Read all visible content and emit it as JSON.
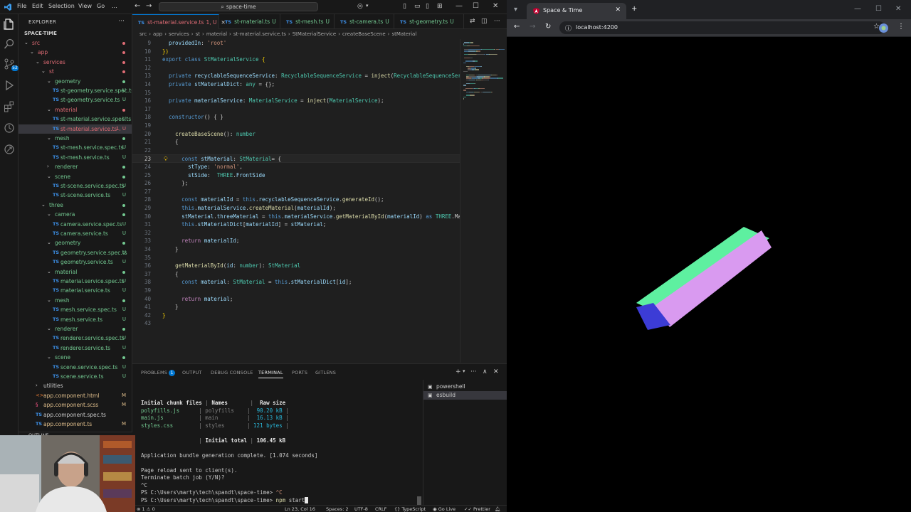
{
  "titlebar": {
    "menu": [
      "File",
      "Edit",
      "Selection",
      "View",
      "Go",
      "..."
    ],
    "search": "space-time"
  },
  "explorer": {
    "header": "EXPLORER",
    "project": "SPACE-TIME",
    "outline": "OUTLINE",
    "rows": [
      {
        "label": "src",
        "depth": 0,
        "kind": "folder",
        "open": true,
        "color": "#e06c75",
        "mark": "dot-red"
      },
      {
        "label": "app",
        "depth": 1,
        "kind": "folder",
        "open": true,
        "color": "#e06c75",
        "mark": "dot-red"
      },
      {
        "label": "services",
        "depth": 2,
        "kind": "folder",
        "open": true,
        "color": "#e06c75",
        "mark": "dot-red"
      },
      {
        "label": "st",
        "depth": 3,
        "kind": "folder",
        "open": true,
        "color": "#e06c75",
        "mark": "dot-red"
      },
      {
        "label": "geometry",
        "depth": 4,
        "kind": "folder",
        "open": true,
        "color": "#73c991",
        "mark": "dot"
      },
      {
        "label": "st-geometry.service.spec.ts",
        "depth": 5,
        "kind": "ts",
        "color": "#73c991",
        "mark": "U"
      },
      {
        "label": "st-geometry.service.ts",
        "depth": 5,
        "kind": "ts",
        "color": "#73c991",
        "mark": "U"
      },
      {
        "label": "material",
        "depth": 4,
        "kind": "folder",
        "open": true,
        "color": "#e06c75",
        "mark": "dot-red"
      },
      {
        "label": "st-material.service.spec.ts",
        "depth": 5,
        "kind": "ts",
        "color": "#73c991",
        "mark": "U"
      },
      {
        "label": "st-material.service.ts",
        "depth": 5,
        "kind": "ts",
        "color": "#e06c75",
        "mark": "1, U",
        "selected": true
      },
      {
        "label": "mesh",
        "depth": 4,
        "kind": "folder",
        "open": true,
        "color": "#73c991",
        "mark": "dot"
      },
      {
        "label": "st-mesh.service.spec.ts",
        "depth": 5,
        "kind": "ts",
        "color": "#73c991",
        "mark": "U"
      },
      {
        "label": "st-mesh.service.ts",
        "depth": 5,
        "kind": "ts",
        "color": "#73c991",
        "mark": "U"
      },
      {
        "label": "renderer",
        "depth": 4,
        "kind": "folder",
        "open": false,
        "color": "#73c991",
        "mark": "dot"
      },
      {
        "label": "scene",
        "depth": 4,
        "kind": "folder",
        "open": true,
        "color": "#73c991",
        "mark": "dot"
      },
      {
        "label": "st-scene.service.spec.ts",
        "depth": 5,
        "kind": "ts",
        "color": "#73c991",
        "mark": "U"
      },
      {
        "label": "st-scene.service.ts",
        "depth": 5,
        "kind": "ts",
        "color": "#73c991",
        "mark": "U"
      },
      {
        "label": "three",
        "depth": 3,
        "kind": "folder",
        "open": true,
        "color": "#73c991",
        "mark": "dot"
      },
      {
        "label": "camera",
        "depth": 4,
        "kind": "folder",
        "open": true,
        "color": "#73c991",
        "mark": "dot"
      },
      {
        "label": "camera.service.spec.ts",
        "depth": 5,
        "kind": "ts",
        "color": "#73c991",
        "mark": "U"
      },
      {
        "label": "camera.service.ts",
        "depth": 5,
        "kind": "ts",
        "color": "#73c991",
        "mark": "U"
      },
      {
        "label": "geometry",
        "depth": 4,
        "kind": "folder",
        "open": true,
        "color": "#73c991",
        "mark": "dot"
      },
      {
        "label": "geometry.service.spec.ts",
        "depth": 5,
        "kind": "ts",
        "color": "#73c991",
        "mark": "U"
      },
      {
        "label": "geometry.service.ts",
        "depth": 5,
        "kind": "ts",
        "color": "#73c991",
        "mark": "U"
      },
      {
        "label": "material",
        "depth": 4,
        "kind": "folder",
        "open": true,
        "color": "#73c991",
        "mark": "dot"
      },
      {
        "label": "material.service.spec.ts",
        "depth": 5,
        "kind": "ts",
        "color": "#73c991",
        "mark": "U"
      },
      {
        "label": "material.service.ts",
        "depth": 5,
        "kind": "ts",
        "color": "#73c991",
        "mark": "U"
      },
      {
        "label": "mesh",
        "depth": 4,
        "kind": "folder",
        "open": true,
        "color": "#73c991",
        "mark": "dot"
      },
      {
        "label": "mesh.service.spec.ts",
        "depth": 5,
        "kind": "ts",
        "color": "#73c991",
        "mark": "U"
      },
      {
        "label": "mesh.service.ts",
        "depth": 5,
        "kind": "ts",
        "color": "#73c991",
        "mark": "U"
      },
      {
        "label": "renderer",
        "depth": 4,
        "kind": "folder",
        "open": true,
        "color": "#73c991",
        "mark": "dot"
      },
      {
        "label": "renderer.service.spec.ts",
        "depth": 5,
        "kind": "ts",
        "color": "#73c991",
        "mark": "U"
      },
      {
        "label": "renderer.service.ts",
        "depth": 5,
        "kind": "ts",
        "color": "#73c991",
        "mark": "U"
      },
      {
        "label": "scene",
        "depth": 4,
        "kind": "folder",
        "open": true,
        "color": "#73c991",
        "mark": "dot"
      },
      {
        "label": "scene.service.spec.ts",
        "depth": 5,
        "kind": "ts",
        "color": "#73c991",
        "mark": "U"
      },
      {
        "label": "scene.service.ts",
        "depth": 5,
        "kind": "ts",
        "color": "#73c991",
        "mark": "U"
      },
      {
        "label": "utilities",
        "depth": 2,
        "kind": "folder",
        "open": false,
        "color": "#cccccc",
        "mark": ""
      },
      {
        "label": "app.component.html",
        "depth": 2,
        "kind": "html",
        "color": "#e2c08d",
        "mark": "M"
      },
      {
        "label": "app.component.scss",
        "depth": 2,
        "kind": "scss",
        "color": "#e2c08d",
        "mark": "M"
      },
      {
        "label": "app.component.spec.ts",
        "depth": 2,
        "kind": "spec",
        "color": "#cccccc",
        "mark": ""
      },
      {
        "label": "app.component.ts",
        "depth": 2,
        "kind": "ts",
        "color": "#e2c08d",
        "mark": "M"
      }
    ]
  },
  "tabs": [
    {
      "name": "st-material.service.ts",
      "mark": "1, U",
      "active": true
    },
    {
      "name": "st-material.ts",
      "mark": "U",
      "active": false
    },
    {
      "name": "st-mesh.ts",
      "mark": "U",
      "active": false
    },
    {
      "name": "st-camera.ts",
      "mark": "U",
      "active": false
    },
    {
      "name": "st-geometry.ts",
      "mark": "U",
      "active": false
    }
  ],
  "breadcrumb": [
    "src",
    "app",
    "services",
    "st",
    "material",
    "st-material.service.ts",
    "StMaterialService",
    "createBaseScene",
    "stMaterial"
  ],
  "code": [
    {
      "n": "9",
      "t": [
        [
          "p",
          "  "
        ],
        [
          "v",
          "providedIn"
        ],
        [
          "p",
          ": "
        ],
        [
          "s",
          "'root'"
        ]
      ]
    },
    {
      "n": "10",
      "t": [
        [
          "b",
          "})"
        ]
      ]
    },
    {
      "n": "11",
      "t": [
        [
          "k",
          "export "
        ],
        [
          "k",
          "class "
        ],
        [
          "t",
          "StMaterialService "
        ],
        [
          "b",
          "{"
        ]
      ]
    },
    {
      "n": "12",
      "t": []
    },
    {
      "n": "13",
      "t": [
        [
          "p",
          "  "
        ],
        [
          "k",
          "private "
        ],
        [
          "v",
          "recyclableSequenceService"
        ],
        [
          "p",
          ": "
        ],
        [
          "t",
          "RecyclableSequenceService"
        ],
        [
          "p",
          " = "
        ],
        [
          "f",
          "inject"
        ],
        [
          "p",
          "("
        ],
        [
          "t",
          "RecyclableSequenceService"
        ],
        [
          "p",
          ");"
        ]
      ]
    },
    {
      "n": "14",
      "t": [
        [
          "p",
          "  "
        ],
        [
          "k",
          "private "
        ],
        [
          "v",
          "stMaterialDict"
        ],
        [
          "p",
          ": "
        ],
        [
          "t",
          "any"
        ],
        [
          "p",
          " = {};"
        ]
      ]
    },
    {
      "n": "15",
      "t": []
    },
    {
      "n": "16",
      "t": [
        [
          "p",
          "  "
        ],
        [
          "k",
          "private "
        ],
        [
          "v",
          "materialService"
        ],
        [
          "p",
          ": "
        ],
        [
          "t",
          "MaterialService"
        ],
        [
          "p",
          " = "
        ],
        [
          "f",
          "inject"
        ],
        [
          "p",
          "("
        ],
        [
          "t",
          "MaterialService"
        ],
        [
          "p",
          ");"
        ]
      ]
    },
    {
      "n": "17",
      "t": []
    },
    {
      "n": "18",
      "t": [
        [
          "p",
          "  "
        ],
        [
          "k",
          "constructor"
        ],
        [
          "p",
          "() { }"
        ]
      ]
    },
    {
      "n": "19",
      "t": []
    },
    {
      "n": "20",
      "t": [
        [
          "p",
          "    "
        ],
        [
          "f",
          "createBaseScene"
        ],
        [
          "p",
          "(): "
        ],
        [
          "t",
          "number"
        ]
      ]
    },
    {
      "n": "21",
      "t": [
        [
          "p",
          "    {"
        ]
      ]
    },
    {
      "n": "22",
      "t": []
    },
    {
      "n": "23",
      "t": [
        [
          "p",
          "      "
        ],
        [
          "k",
          "const "
        ],
        [
          "v",
          "stMaterial"
        ],
        [
          "p",
          ": "
        ],
        [
          "t",
          "StMaterial"
        ],
        [
          "p",
          "= {"
        ]
      ],
      "cur": true
    },
    {
      "n": "24",
      "t": [
        [
          "p",
          "        "
        ],
        [
          "v",
          "stType"
        ],
        [
          "p",
          ": "
        ],
        [
          "s",
          "'normal'"
        ],
        [
          "p",
          ","
        ]
      ]
    },
    {
      "n": "25",
      "t": [
        [
          "p",
          "        "
        ],
        [
          "v",
          "stSide"
        ],
        [
          "p",
          ":  "
        ],
        [
          "t",
          "THREE"
        ],
        [
          "p",
          "."
        ],
        [
          "v",
          "FrontSide"
        ]
      ]
    },
    {
      "n": "26",
      "t": [
        [
          "p",
          "      };"
        ]
      ]
    },
    {
      "n": "27",
      "t": []
    },
    {
      "n": "28",
      "t": [
        [
          "p",
          "      "
        ],
        [
          "k",
          "const "
        ],
        [
          "v",
          "materialId"
        ],
        [
          "p",
          " = "
        ],
        [
          "k",
          "this"
        ],
        [
          "p",
          "."
        ],
        [
          "v",
          "recyclableSequenceService"
        ],
        [
          "p",
          "."
        ],
        [
          "f",
          "generateId"
        ],
        [
          "p",
          "();"
        ]
      ]
    },
    {
      "n": "29",
      "t": [
        [
          "p",
          "      "
        ],
        [
          "k",
          "this"
        ],
        [
          "p",
          "."
        ],
        [
          "v",
          "materialService"
        ],
        [
          "p",
          "."
        ],
        [
          "f",
          "createMaterial"
        ],
        [
          "p",
          "("
        ],
        [
          "v",
          "materialId"
        ],
        [
          "p",
          ");"
        ]
      ]
    },
    {
      "n": "30",
      "t": [
        [
          "p",
          "      "
        ],
        [
          "v",
          "stMaterial"
        ],
        [
          "p",
          "."
        ],
        [
          "v",
          "threeMaterial"
        ],
        [
          "p",
          " = "
        ],
        [
          "k",
          "this"
        ],
        [
          "p",
          "."
        ],
        [
          "v",
          "materialService"
        ],
        [
          "p",
          "."
        ],
        [
          "f",
          "getMaterialById"
        ],
        [
          "p",
          "("
        ],
        [
          "v",
          "materialId"
        ],
        [
          "p",
          ") "
        ],
        [
          "k",
          "as "
        ],
        [
          "t",
          "THREE"
        ],
        [
          "p",
          ".Material;"
        ]
      ]
    },
    {
      "n": "31",
      "t": [
        [
          "p",
          "      "
        ],
        [
          "k",
          "this"
        ],
        [
          "p",
          "."
        ],
        [
          "v",
          "stMaterialDict"
        ],
        [
          "p",
          "["
        ],
        [
          "v",
          "materialId"
        ],
        [
          "p",
          "] = "
        ],
        [
          "v",
          "stMaterial"
        ],
        [
          "p",
          ";"
        ]
      ]
    },
    {
      "n": "32",
      "t": []
    },
    {
      "n": "33",
      "t": [
        [
          "p",
          "      "
        ],
        [
          "kw",
          "return "
        ],
        [
          "v",
          "materialId"
        ],
        [
          "p",
          ";"
        ]
      ]
    },
    {
      "n": "34",
      "t": [
        [
          "p",
          "    }"
        ]
      ]
    },
    {
      "n": "35",
      "t": []
    },
    {
      "n": "36",
      "t": [
        [
          "p",
          "    "
        ],
        [
          "f",
          "getMaterialById"
        ],
        [
          "p",
          "("
        ],
        [
          "v",
          "id"
        ],
        [
          "p",
          ": "
        ],
        [
          "t",
          "number"
        ],
        [
          "p",
          "): "
        ],
        [
          "t",
          "StMaterial"
        ]
      ]
    },
    {
      "n": "37",
      "t": [
        [
          "p",
          "    {"
        ]
      ]
    },
    {
      "n": "38",
      "t": [
        [
          "p",
          "      "
        ],
        [
          "k",
          "const "
        ],
        [
          "v",
          "material"
        ],
        [
          "p",
          ": "
        ],
        [
          "t",
          "StMaterial"
        ],
        [
          "p",
          " = "
        ],
        [
          "k",
          "this"
        ],
        [
          "p",
          "."
        ],
        [
          "v",
          "stMaterialDict"
        ],
        [
          "p",
          "["
        ],
        [
          "v",
          "id"
        ],
        [
          "p",
          "];"
        ]
      ]
    },
    {
      "n": "39",
      "t": []
    },
    {
      "n": "40",
      "t": [
        [
          "p",
          "      "
        ],
        [
          "kw",
          "return "
        ],
        [
          "v",
          "material"
        ],
        [
          "p",
          ";"
        ]
      ]
    },
    {
      "n": "41",
      "t": [
        [
          "p",
          "    }"
        ]
      ]
    },
    {
      "n": "42",
      "t": [
        [
          "b",
          "}"
        ]
      ]
    },
    {
      "n": "43",
      "t": []
    }
  ],
  "panel": {
    "tabs": [
      "PROBLEMS",
      "OUTPUT",
      "DEBUG CONSOLE",
      "TERMINAL",
      "PORTS",
      "GITLENS"
    ],
    "problems_count": "1",
    "terminals": [
      "powershell",
      "esbuild"
    ],
    "terminal_lines": [
      [
        [
          "bold",
          "Initial chunk files"
        ],
        [
          "dim",
          " | "
        ],
        [
          "bold",
          "Names"
        ],
        [
          "p",
          "       "
        ],
        [
          "dim",
          "| "
        ],
        [
          "bold",
          " Raw size"
        ]
      ],
      [
        [
          "g",
          "polyfills.js"
        ],
        [
          "p",
          "      "
        ],
        [
          "dim",
          "| polyfills    |  "
        ],
        [
          "cy",
          "90.20 kB"
        ],
        [
          "dim",
          " |"
        ]
      ],
      [
        [
          "g",
          "main.js"
        ],
        [
          "p",
          "           "
        ],
        [
          "dim",
          "| main         |  "
        ],
        [
          "cy",
          "16.13 kB"
        ],
        [
          "dim",
          " |"
        ]
      ],
      [
        [
          "g",
          "styles.css"
        ],
        [
          "p",
          "        "
        ],
        [
          "dim",
          "| styles       | "
        ],
        [
          "cy",
          "121 bytes"
        ],
        [
          "dim",
          " |"
        ]
      ],
      [],
      [
        [
          "p",
          "                  "
        ],
        [
          "dim",
          "| "
        ],
        [
          "bold",
          "Initial total"
        ],
        [
          "dim",
          " | "
        ],
        [
          "bold",
          "106.45 kB"
        ]
      ],
      [],
      [
        [
          "p",
          "Application bundle generation complete. [1.074 seconds]"
        ]
      ],
      [],
      [
        [
          "p",
          "Page reload sent to client(s)."
        ]
      ],
      [
        [
          "p",
          "Terminate batch job (Y/N)?"
        ]
      ],
      [
        [
          "p",
          "^C"
        ]
      ],
      [
        [
          "p",
          "PS C:\\Users\\marty\\tech\\spandt\\space-time> "
        ],
        [
          "s",
          "^C"
        ]
      ],
      [
        [
          "p",
          "PS C:\\Users\\marty\\tech\\spandt\\space-time> "
        ],
        [
          "f",
          "npm"
        ],
        [
          "p",
          " start"
        ]
      ]
    ]
  },
  "statusbar": {
    "left": "⊗ 1 ⚠ 0",
    "position": "Ln 23, Col 16",
    "spaces": "Spaces: 2",
    "encoding": "UTF-8",
    "eol": "CRLF",
    "language": "TypeScript",
    "golive": "Go Live",
    "prettier": "Prettier"
  },
  "browser": {
    "tab_title": "Space & Time",
    "url": "localhost:4200"
  },
  "colors": {
    "box_top": "#5ef0a0",
    "box_front": "#d99af0",
    "box_end": "#3c3cd6"
  }
}
